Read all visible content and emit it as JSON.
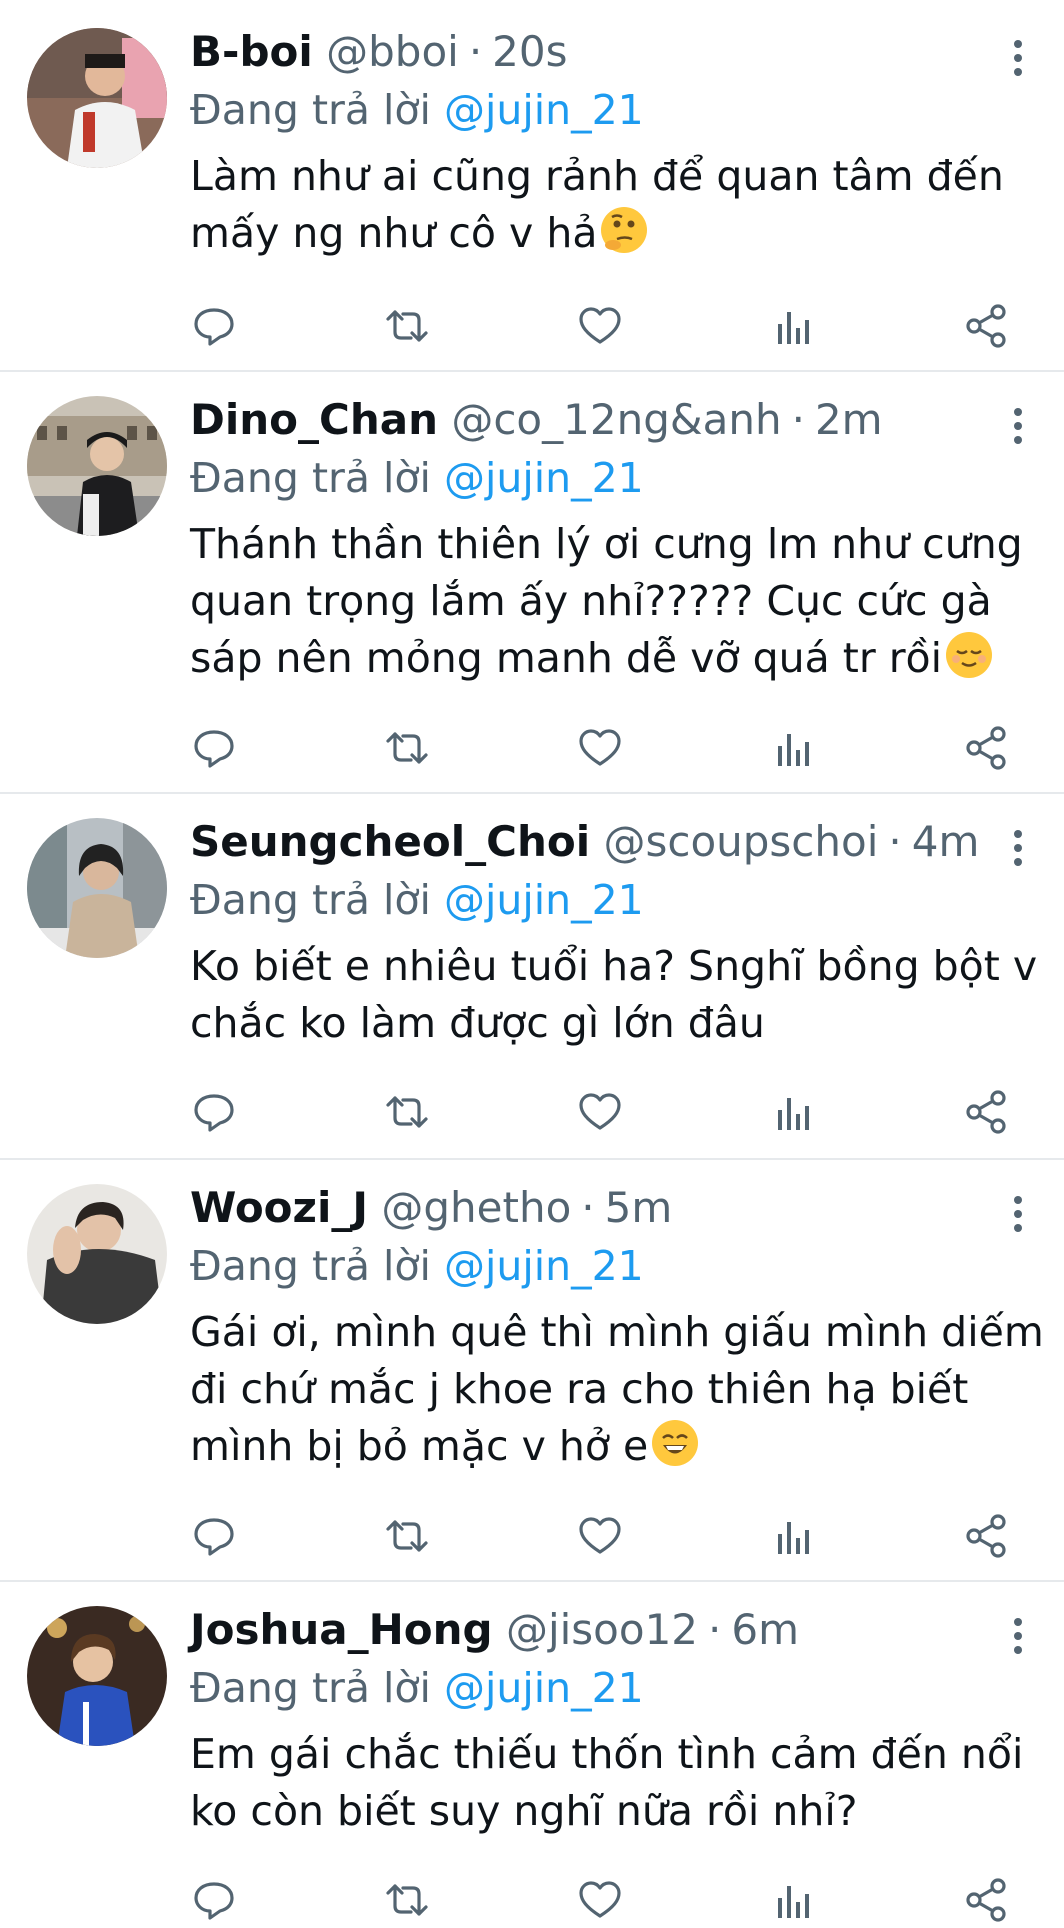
{
  "colors": {
    "accent": "#1d9bf0",
    "muted": "#536471",
    "text": "#0f1419",
    "divider": "#e6e9ec"
  },
  "reply_prefix": "Đang trả lời",
  "tweets": [
    {
      "name": "B-boi",
      "handle": "@bboi",
      "separator": "·",
      "time": "20s",
      "mention": "@jujin_21",
      "lines": [
        "Làm như ai cũng rảnh để quan tâm đến",
        "mấy ng như cô v hả"
      ],
      "emoji": "thinking-face"
    },
    {
      "name": "Dino_Chan",
      "handle": "@co_12ng&anh",
      "separator": "·",
      "time": "2m",
      "mention": "@jujin_21",
      "lines": [
        "Thánh thần thiên lý ơi cưng lm như cưng",
        "quan trọng lắm ấy nhỉ????? Cục cức gà",
        "sáp nên mỏng manh dễ vỡ quá tr rồi"
      ],
      "emoji": "relieved-face"
    },
    {
      "name": "Seungcheol_Choi",
      "handle": "@scoupschoi",
      "separator": "·",
      "time": "4m",
      "mention": "@jujin_21",
      "lines": [
        "Ko biết e nhiêu tuổi ha? Snghĩ bồng bột v",
        "chắc ko làm được gì lớn đâu"
      ],
      "emoji": ""
    },
    {
      "name": "Woozi_J",
      "handle": "@ghetho",
      "separator": "·",
      "time": "5m",
      "mention": "@jujin_21",
      "lines": [
        "Gái ơi, mình quê thì mình giấu mình diếm",
        "đi chứ mắc j khoe ra cho thiên hạ biết",
        "mình bị bỏ mặc v hở e"
      ],
      "emoji": "grinning-face"
    },
    {
      "name": "Joshua_Hong",
      "handle": "@jisoo12",
      "separator": "·",
      "time": "6m",
      "mention": "@jujin_21",
      "lines": [
        "Em gái chắc thiếu thốn tình cảm đến nổi",
        "ko còn biết suy nghĩ nữa rồi nhỉ?"
      ],
      "emoji": ""
    }
  ]
}
